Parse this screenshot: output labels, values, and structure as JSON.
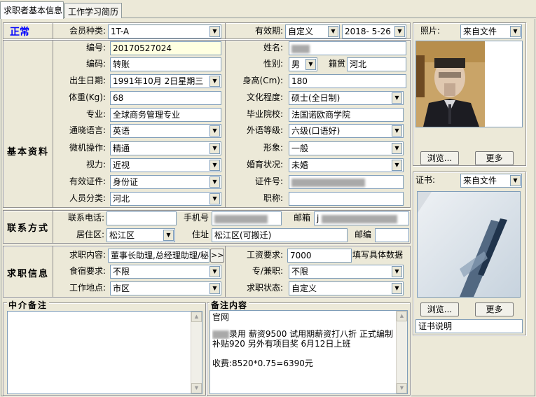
{
  "tabs": [
    "求职者基本信息",
    "工作学习简历"
  ],
  "status": "正常",
  "colors": {
    "status": "#0000ff",
    "input_border": "#7f9db9",
    "panel": "#ece9d8",
    "highlight": "#ffffe1"
  },
  "membership": {
    "label": "会员种类:",
    "value": "1T-A"
  },
  "validity": {
    "label": "有效期:",
    "mode": "自定义",
    "date": "2018- 5-26"
  },
  "sections": {
    "basic": "基本资料",
    "contact": "联系方式",
    "job": "求职信息",
    "agent_note": "中介备注",
    "note_content": "备注内容"
  },
  "basic": {
    "number_label": "编号:",
    "number": "20170527024",
    "name_label": "姓名:",
    "code_label": "编码:",
    "code": "转账",
    "gender_label": "性别:",
    "gender": "男",
    "origin_label": "籍贯",
    "origin": "河北",
    "birth_label": "出生日期:",
    "birth": "1991年10月 2日星期三",
    "height_label": "身高(Cm):",
    "height": "180",
    "weight_label": "体重(Kg):",
    "weight": "68",
    "edu_label": "文化程度:",
    "edu": "硕士(全日制)",
    "major_label": "专业:",
    "major": "全球商务管理专业",
    "school_label": "毕业院校:",
    "school": "法国诺欧商学院",
    "lang_label": "通晓语言:",
    "lang": "英语",
    "lang_level_label": "外语等级:",
    "lang_level": "六级(口语好)",
    "computer_label": "微机操作:",
    "computer": "精通",
    "image_label": "形象:",
    "image": "一般",
    "vision_label": "视力:",
    "vision": "近视",
    "marital_label": "婚育状况:",
    "marital": "未婚",
    "id_type_label": "有效证件:",
    "id_type": "身份证",
    "id_no_label": "证件号:",
    "category_label": "人员分类:",
    "category": "河北",
    "title_label": "职称:",
    "title": ""
  },
  "contact": {
    "phone_label": "联系电话:",
    "phone": "",
    "mobile_label": "手机号",
    "email_label": "邮箱",
    "email_prefix": "j",
    "district_label": "居住区:",
    "district": "松江区",
    "address_label": "住址",
    "address": "松江区(可搬迁)",
    "postcode_label": "邮编",
    "postcode": ""
  },
  "job": {
    "content_label": "求职内容:",
    "content": "董事长助理,总经理助理/秘",
    "more_btn": ">>",
    "salary_label": "工资要求:",
    "salary": "7000",
    "salary_hint": "填写具体数据",
    "board_label": "食宿要求:",
    "board": "不限",
    "fulltime_label": "专/兼职:",
    "fulltime": "不限",
    "location_label": "工作地点:",
    "location": "市区",
    "status_label": "求职状态:",
    "status": "自定义"
  },
  "note": {
    "line1": "官网",
    "line2": "录用 薪资9500 试用期薪资打八折 正式编制",
    "line3": "补贴920 另外有项目奖 6月12日上班",
    "line4": "",
    "line5": "收费:8520*0.75=6390元"
  },
  "photo": {
    "label": "照片:",
    "source": "来自文件",
    "browse": "浏览...",
    "more": "更多"
  },
  "cert": {
    "label": "证书:",
    "source": "来自文件",
    "browse": "浏览...",
    "more": "更多",
    "desc": "证书说明"
  }
}
